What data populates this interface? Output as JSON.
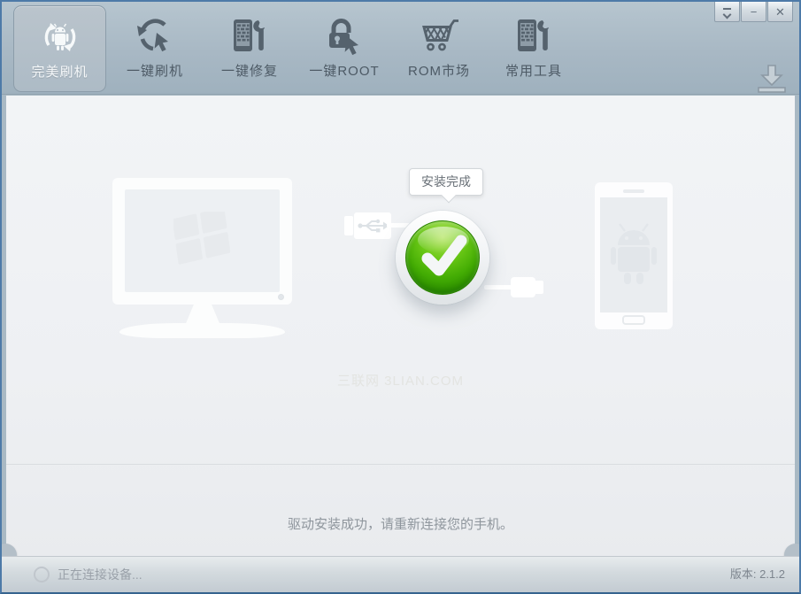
{
  "app": {
    "name": "完美刷机"
  },
  "window_controls": {
    "minimize_label": "−",
    "close_label": "✕"
  },
  "toolbar": {
    "tabs": [
      {
        "label": "完美刷机",
        "selected": true,
        "icon": "android-refresh-icon"
      },
      {
        "label": "一键刷机",
        "selected": false,
        "icon": "refresh-cursor-icon"
      },
      {
        "label": "一键修复",
        "selected": false,
        "icon": "phone-wrench-icon"
      },
      {
        "label": "一键ROOT",
        "selected": false,
        "icon": "lock-cursor-icon"
      },
      {
        "label": "ROM市场",
        "selected": false,
        "icon": "shopping-cart-icon"
      },
      {
        "label": "常用工具",
        "selected": false,
        "icon": "phone-wrench-icon"
      }
    ]
  },
  "main": {
    "tooltip_label": "安装完成",
    "watermark": "三联网 3LIAN.COM",
    "message": "驱动安装成功，请重新连接您的手机。"
  },
  "statusbar": {
    "status_text": "正在连接设备...",
    "version_text": "版本: 2.1.2"
  },
  "colors": {
    "accent_green": "#3fa700",
    "toolbar_bg": "#a9b9c4",
    "window_border": "#4d7aa8",
    "icon_gray": "#55626d"
  }
}
